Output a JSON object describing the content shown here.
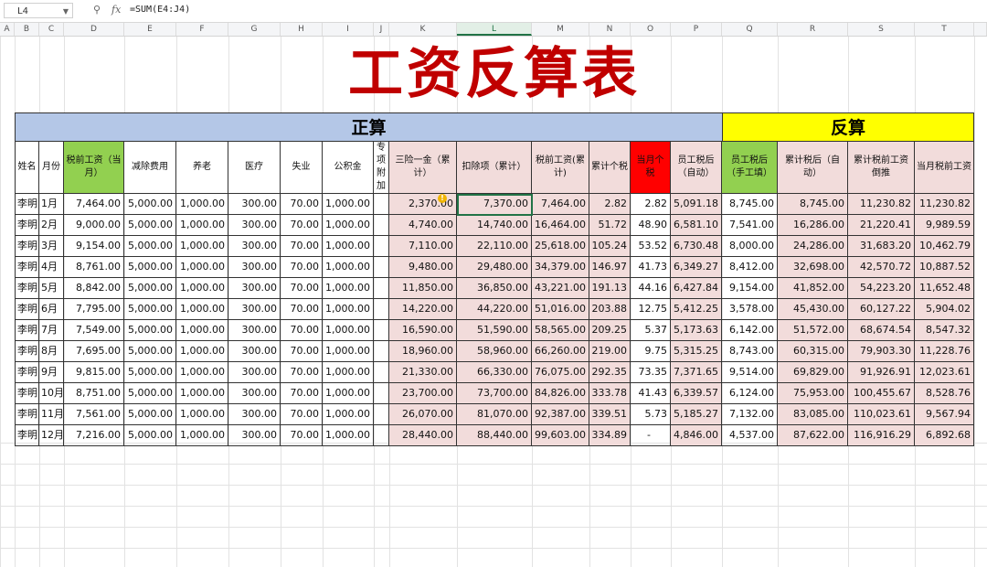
{
  "formula_bar": {
    "name_box": "L4",
    "zoom_icon": "zoom-icon",
    "fx_label": "fx",
    "formula": "=SUM(E4:J4)"
  },
  "columns": [
    "A",
    "B",
    "C",
    "D",
    "E",
    "F",
    "G",
    "H",
    "I",
    "J",
    "K",
    "L",
    "M",
    "N",
    "O",
    "P",
    "Q",
    "R",
    "S",
    "T"
  ],
  "selected_column": "L",
  "sheet_title": "工资反算表",
  "bands": {
    "forward": "正算",
    "reverse": "反算"
  },
  "headers": [
    "姓名",
    "月份",
    "税前工资（当月）",
    "减除费用",
    "养老",
    "医疗",
    "失业",
    "公积金",
    "专项附加",
    "三险一金（累计）",
    "扣除项（累计）",
    "税前工资(累计)",
    "累计个税",
    "当月个税",
    "员工税后（自动）",
    "员工税后（手工填）",
    "累计税后（自动）",
    "累计税前工资倒推",
    "当月税前工资"
  ],
  "rows": [
    [
      "李明",
      "1月",
      "7,464.00",
      "5,000.00",
      "1,000.00",
      "300.00",
      "70.00",
      "1,000.00",
      "",
      "2,370.00",
      "7,370.00",
      "7,464.00",
      "2.82",
      "2.82",
      "5,091.18",
      "8,745.00",
      "8,745.00",
      "11,230.82",
      "11,230.82"
    ],
    [
      "李明",
      "2月",
      "9,000.00",
      "5,000.00",
      "1,000.00",
      "300.00",
      "70.00",
      "1,000.00",
      "",
      "4,740.00",
      "14,740.00",
      "16,464.00",
      "51.72",
      "48.90",
      "6,581.10",
      "7,541.00",
      "16,286.00",
      "21,220.41",
      "9,989.59"
    ],
    [
      "李明",
      "3月",
      "9,154.00",
      "5,000.00",
      "1,000.00",
      "300.00",
      "70.00",
      "1,000.00",
      "",
      "7,110.00",
      "22,110.00",
      "25,618.00",
      "105.24",
      "53.52",
      "6,730.48",
      "8,000.00",
      "24,286.00",
      "31,683.20",
      "10,462.79"
    ],
    [
      "李明",
      "4月",
      "8,761.00",
      "5,000.00",
      "1,000.00",
      "300.00",
      "70.00",
      "1,000.00",
      "",
      "9,480.00",
      "29,480.00",
      "34,379.00",
      "146.97",
      "41.73",
      "6,349.27",
      "8,412.00",
      "32,698.00",
      "42,570.72",
      "10,887.52"
    ],
    [
      "李明",
      "5月",
      "8,842.00",
      "5,000.00",
      "1,000.00",
      "300.00",
      "70.00",
      "1,000.00",
      "",
      "11,850.00",
      "36,850.00",
      "43,221.00",
      "191.13",
      "44.16",
      "6,427.84",
      "9,154.00",
      "41,852.00",
      "54,223.20",
      "11,652.48"
    ],
    [
      "李明",
      "6月",
      "7,795.00",
      "5,000.00",
      "1,000.00",
      "300.00",
      "70.00",
      "1,000.00",
      "",
      "14,220.00",
      "44,220.00",
      "51,016.00",
      "203.88",
      "12.75",
      "5,412.25",
      "3,578.00",
      "45,430.00",
      "60,127.22",
      "5,904.02"
    ],
    [
      "李明",
      "7月",
      "7,549.00",
      "5,000.00",
      "1,000.00",
      "300.00",
      "70.00",
      "1,000.00",
      "",
      "16,590.00",
      "51,590.00",
      "58,565.00",
      "209.25",
      "5.37",
      "5,173.63",
      "6,142.00",
      "51,572.00",
      "68,674.54",
      "8,547.32"
    ],
    [
      "李明",
      "8月",
      "7,695.00",
      "5,000.00",
      "1,000.00",
      "300.00",
      "70.00",
      "1,000.00",
      "",
      "18,960.00",
      "58,960.00",
      "66,260.00",
      "219.00",
      "9.75",
      "5,315.25",
      "8,743.00",
      "60,315.00",
      "79,903.30",
      "11,228.76"
    ],
    [
      "李明",
      "9月",
      "9,815.00",
      "5,000.00",
      "1,000.00",
      "300.00",
      "70.00",
      "1,000.00",
      "",
      "21,330.00",
      "66,330.00",
      "76,075.00",
      "292.35",
      "73.35",
      "7,371.65",
      "9,514.00",
      "69,829.00",
      "91,926.91",
      "12,023.61"
    ],
    [
      "李明",
      "10月",
      "8,751.00",
      "5,000.00",
      "1,000.00",
      "300.00",
      "70.00",
      "1,000.00",
      "",
      "23,700.00",
      "73,700.00",
      "84,826.00",
      "333.78",
      "41.43",
      "6,339.57",
      "6,124.00",
      "75,953.00",
      "100,455.67",
      "8,528.76"
    ],
    [
      "李明",
      "11月",
      "7,561.00",
      "5,000.00",
      "1,000.00",
      "300.00",
      "70.00",
      "1,000.00",
      "",
      "26,070.00",
      "81,070.00",
      "92,387.00",
      "339.51",
      "5.73",
      "5,185.27",
      "7,132.00",
      "83,085.00",
      "110,023.61",
      "9,567.94"
    ],
    [
      "李明",
      "12月",
      "7,216.00",
      "5,000.00",
      "1,000.00",
      "300.00",
      "70.00",
      "1,000.00",
      "",
      "28,440.00",
      "88,440.00",
      "99,603.00",
      "334.89",
      "-",
      "4,846.00",
      "4,537.00",
      "87,622.00",
      "116,916.29",
      "6,892.68"
    ]
  ],
  "colors": {
    "title": "#c00000",
    "forward_band": "#b4c7e7",
    "reverse_band": "#ffff00",
    "green_header": "#92d050",
    "red_header": "#ff0000",
    "pink_cell": "#f2dcdb",
    "selection": "#217346"
  },
  "warning_icon": "warning-icon"
}
